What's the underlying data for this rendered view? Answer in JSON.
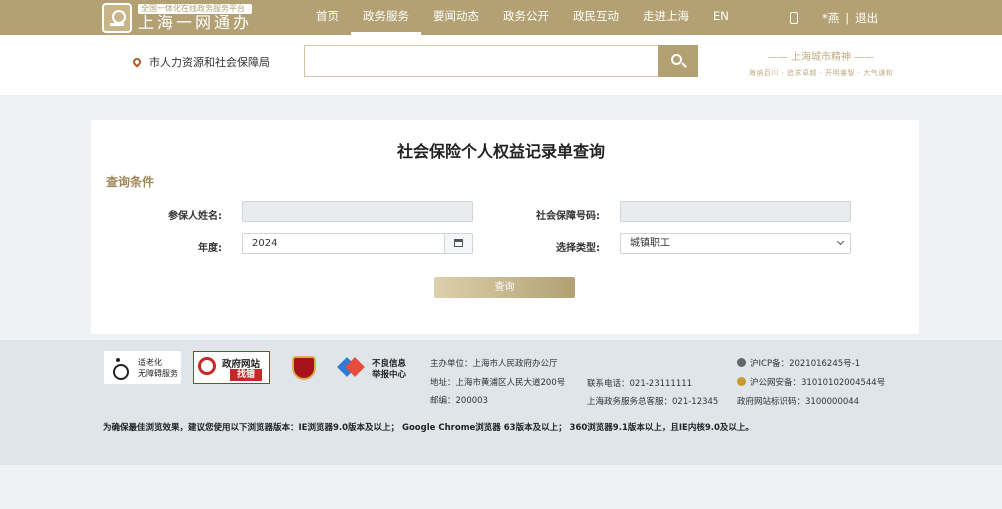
{
  "topbar": {
    "logo_tag": "全国一体化在线政务服务平台",
    "logo_title": "上海一网通办",
    "nav": [
      "首页",
      "政务服务",
      "要闻动态",
      "政务公开",
      "政民互动",
      "走进上海",
      "EN"
    ],
    "active_nav": "政务服务",
    "user": "*燕",
    "separator": "|",
    "logout": "退出"
  },
  "header": {
    "department": "市人力资源和社会保障局",
    "search_value": "",
    "spirit_title": "—— 上海城市精神 ——",
    "spirit_sub": "海纳百川 · 追求卓越 · 开明睿智 · 大气谦和"
  },
  "form": {
    "title": "社会保险个人权益记录单查询",
    "section": "查询条件",
    "name_label": "参保人姓名:",
    "name_value": "",
    "ssn_label": "社会保障号码:",
    "ssn_value": "",
    "year_label": "年度:",
    "year_value": "2024",
    "type_label": "选择类型:",
    "type_value": "城镇职工",
    "submit": "查询"
  },
  "footer": {
    "accessibility_line1": "适老化",
    "accessibility_line2": "无障碍服务",
    "zhaocuo_title": "政府网站",
    "zhaocuo_sub": "找错",
    "report_line1": "不良信息",
    "report_line2": "举报中心",
    "sponsor": "主办单位：上海市人民政府办公厅",
    "address": "地址：上海市黄浦区人民大道200号",
    "postcode": "邮编：200003",
    "phone": "联系电话：021-23111111",
    "service_phone": "上海政务服务总客服：021-12345",
    "icp": "沪ICP备：2021016245号-1",
    "police": "沪公网安备：31010102004544号",
    "site_code": "政府网站标识码：3100000044",
    "browser_note": "为确保最佳浏览效果，建议您使用以下浏览器版本：IE浏览器9.0版本及以上； Google Chrome浏览器 63版本及以上； 360浏览器9.1版本以上，且IE内核9.0及以上。"
  }
}
